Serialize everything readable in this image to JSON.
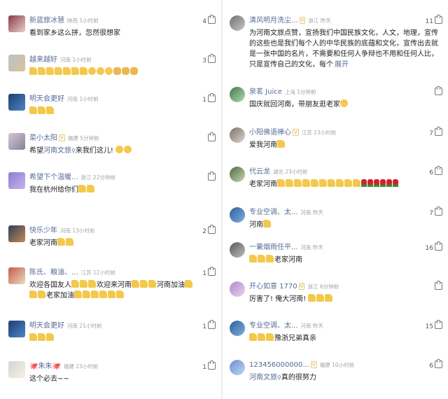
{
  "left": [
    {
      "user": "新蓝旅冰慧",
      "meta": "陕西 1小时前",
      "likes": "4",
      "vip": false,
      "segments": [
        {
          "t": "看到家乡这么拼，忽然很想家"
        }
      ],
      "avatar": [
        "#8a3a4a",
        "#e8d0c8"
      ]
    },
    {
      "user": "越来越好",
      "meta": "河南 1小时前",
      "likes": "3",
      "vip": false,
      "segments": [
        {
          "e": "thumb",
          "n": 7
        },
        {
          "e": "face",
          "n": 3
        },
        {
          "e": "fist",
          "n": 3
        }
      ],
      "avatar": [
        "#b8c4c9",
        "#d8c29a"
      ]
    },
    {
      "user": "明天会更好",
      "meta": "河南 1小时前",
      "likes": "1",
      "vip": false,
      "segments": [
        {
          "e": "thumb",
          "n": 3
        }
      ],
      "avatar": [
        "#1b3f72",
        "#4e86c6"
      ]
    },
    {
      "user": "菜小太阳",
      "meta": "福建 5分钟前",
      "likes": "",
      "vip": true,
      "segments": [
        {
          "t": "希望"
        },
        {
          "link": "河南文旅"
        },
        {
          "t": "来我们这儿! "
        },
        {
          "e": "face",
          "n": 2
        }
      ],
      "avatar": [
        "#d0c8d8",
        "#8a8090"
      ]
    },
    {
      "user": "希望下个温暖...",
      "meta": "浙江 22分钟前",
      "likes": "",
      "vip": false,
      "segments": [
        {
          "t": "我在杭州给你们"
        },
        {
          "e": "thumb",
          "n": 2
        }
      ],
      "avatar": [
        "#8e7bd0",
        "#c3b5ef"
      ]
    },
    {
      "user": "快乐少年",
      "meta": "河南 13小时前",
      "likes": "2",
      "vip": false,
      "segments": [
        {
          "t": "老家河南"
        },
        {
          "e": "thumb",
          "n": 2
        }
      ],
      "avatar": [
        "#2e3e5a",
        "#c48a55"
      ]
    },
    {
      "user": "陈氏、粮油、...",
      "meta": "江苏 12小时前",
      "likes": "1",
      "vip": false,
      "segments": [
        {
          "t": "欢迎各国友人"
        },
        {
          "e": "thumb",
          "n": 3
        },
        {
          "t": "欢迎来河南"
        },
        {
          "e": "thumb",
          "n": 3
        },
        {
          "t": "河南加油"
        },
        {
          "e": "thumb",
          "n": 1
        },
        {
          "br": true
        },
        {
          "e": "thumb",
          "n": 2
        },
        {
          "t": "老家加油"
        },
        {
          "e": "thumb",
          "n": 6
        }
      ],
      "avatar": [
        "#c95a48",
        "#e9dcc0"
      ]
    },
    {
      "user": "明天会更好",
      "meta": "河南 21小时前",
      "likes": "1",
      "vip": false,
      "segments": [
        {
          "e": "thumb",
          "n": 3
        }
      ],
      "avatar": [
        "#1b3f72",
        "#4e86c6"
      ]
    },
    {
      "user": "🐙朱朱🐙",
      "meta": "福建 23小时前",
      "likes": "1",
      "vip": false,
      "segments": [
        {
          "t": "这个必去~~"
        }
      ],
      "avatar": [
        "#d9d4cf",
        "#f3efe9"
      ]
    }
  ],
  "right": [
    {
      "user": "清风明月洗尘...",
      "meta": "浙江 昨天",
      "likes": "11",
      "vip": true,
      "segments": [
        {
          "t": "为河南文旅点赞，宣扬我们中国民族文化，人文，地理，宣传的这些也是我们每个人的中华民族的底蕴和文化，宣传出去就是一张中国的名片，不需要和任何人争辩也不用和任何人比，只是宣传自己的文化，每个"
        }
      ],
      "expand": "展开",
      "avatar": [
        "#6f6f6f",
        "#c9c9c9"
      ]
    },
    {
      "user": "泉茗 Juice",
      "meta": "上海 1分钟前",
      "likes": "",
      "vip": false,
      "segments": [
        {
          "t": "国庆就回河南，带朋友逛老家"
        },
        {
          "e": "face",
          "n": 1
        }
      ],
      "avatar": [
        "#3d7a4a",
        "#b7d9b0"
      ]
    },
    {
      "user": "小阳佛语禅心",
      "meta": "江苏 23小时前",
      "likes": "7",
      "vip": true,
      "segments": [
        {
          "t": "爱我河南"
        },
        {
          "e": "thumb",
          "n": 1
        }
      ],
      "avatar": [
        "#7a6f66",
        "#ded6cc"
      ]
    },
    {
      "user": "代云龙",
      "meta": "湖北 23小时前",
      "likes": "6",
      "vip": false,
      "segments": [
        {
          "t": "老家河南"
        },
        {
          "e": "thumb",
          "n": 10
        },
        {
          "e": "rose",
          "n": 6
        }
      ],
      "avatar": [
        "#4e6a3c",
        "#c9d6b3"
      ]
    },
    {
      "user": "专业空调、太...",
      "meta": "河南 昨天",
      "likes": "7",
      "vip": false,
      "segments": [
        {
          "t": "河南"
        },
        {
          "e": "thumb",
          "n": 1
        }
      ],
      "avatar": [
        "#2d5f98",
        "#7fb0e0"
      ]
    },
    {
      "user": "一蓑烟雨任平...",
      "meta": "河南 昨天",
      "likes": "16",
      "vip": false,
      "segments": [
        {
          "e": "thumb",
          "n": 3
        },
        {
          "t": "老家河南"
        }
      ],
      "avatar": [
        "#585858",
        "#bfbfbf"
      ]
    },
    {
      "user": "开心如意 1770",
      "meta": "浙江 6分钟前",
      "likes": "",
      "vip": true,
      "segments": [
        {
          "t": "厉害了! 俺大河南! "
        },
        {
          "e": "thumb",
          "n": 3
        }
      ],
      "avatar": [
        "#b488c8",
        "#e7d4f2"
      ]
    },
    {
      "user": "专业空调、太...",
      "meta": "河南 昨天",
      "likes": "15",
      "vip": false,
      "segments": [
        {
          "e": "thumb",
          "n": 3
        },
        {
          "t": "豫浙兄弟真亲"
        }
      ],
      "avatar": [
        "#2d5f98",
        "#7fb0e0"
      ]
    },
    {
      "user": "123456000000...",
      "meta": "福建 10小时前",
      "likes": "6",
      "vip": true,
      "segments": [
        {
          "link": "河南文旅"
        },
        {
          "t": "真的很努力"
        }
      ],
      "avatar": [
        "#6a8fd0",
        "#c3d6f5"
      ]
    }
  ]
}
